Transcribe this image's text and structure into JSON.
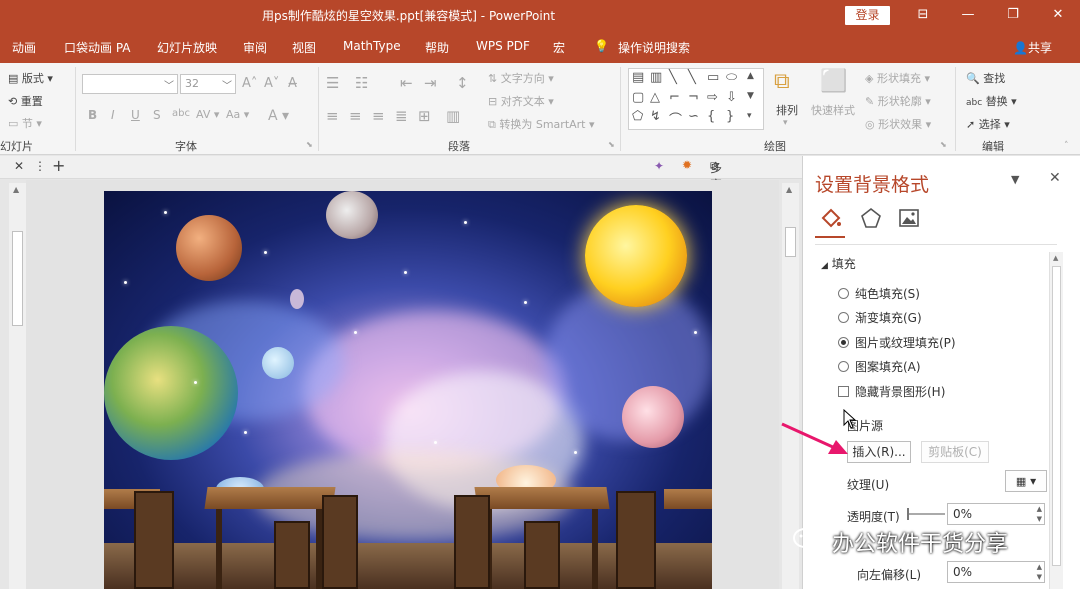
{
  "titlebar": {
    "title": "用ps制作酷炫的星空效果.ppt[兼容模式] - PowerPoint",
    "login": "登录",
    "share": "共享"
  },
  "tabs": [
    "动画",
    "口袋动画 PA",
    "幻灯片放映",
    "审阅",
    "视图",
    "MathType",
    "帮助",
    "WPS PDF",
    "宏"
  ],
  "tell_me": "操作说明搜索",
  "ribbon": {
    "slides": {
      "layout": "版式",
      "reset": "重置",
      "section": "节",
      "label": "幻灯片"
    },
    "font": {
      "size": "32",
      "label": "字体"
    },
    "paragraph": {
      "text_direction": "文字方向",
      "align_text": "对齐文本",
      "smartart": "转换为 SmartArt",
      "label": "段落"
    },
    "drawing": {
      "arrange": "排列",
      "quick_styles": "快速样式",
      "shape_fill": "形状填充",
      "shape_outline": "形状轮廓",
      "shape_effects": "形状效果",
      "label": "绘图"
    },
    "editing": {
      "find": "查找",
      "replace": "替换",
      "select": "选择",
      "label": "编辑"
    }
  },
  "subbar": {
    "multi_window": "多窗口模式"
  },
  "pane": {
    "title": "设置背景格式",
    "section": "填充",
    "options": [
      {
        "label": "纯色填充(S)",
        "selected": false
      },
      {
        "label": "渐变填充(G)",
        "selected": false
      },
      {
        "label": "图片或纹理填充(P)",
        "selected": true
      },
      {
        "label": "图案填充(A)",
        "selected": false
      }
    ],
    "hide_bg": "隐藏背景图形(H)",
    "picture_source": "图片源",
    "insert_btn": "插入(R)...",
    "clipboard_btn": "剪贴板(C)",
    "texture_label": "纹理(U)",
    "transparency_label": "透明度(T)",
    "transparency_value": "0%",
    "offset_left_label": "向左偏移(L)",
    "offset_left_value": "0%"
  },
  "watermark": "办公软件干货分享",
  "colors": {
    "accent": "#b7472a",
    "annotation_arrow": "#e8176c"
  }
}
